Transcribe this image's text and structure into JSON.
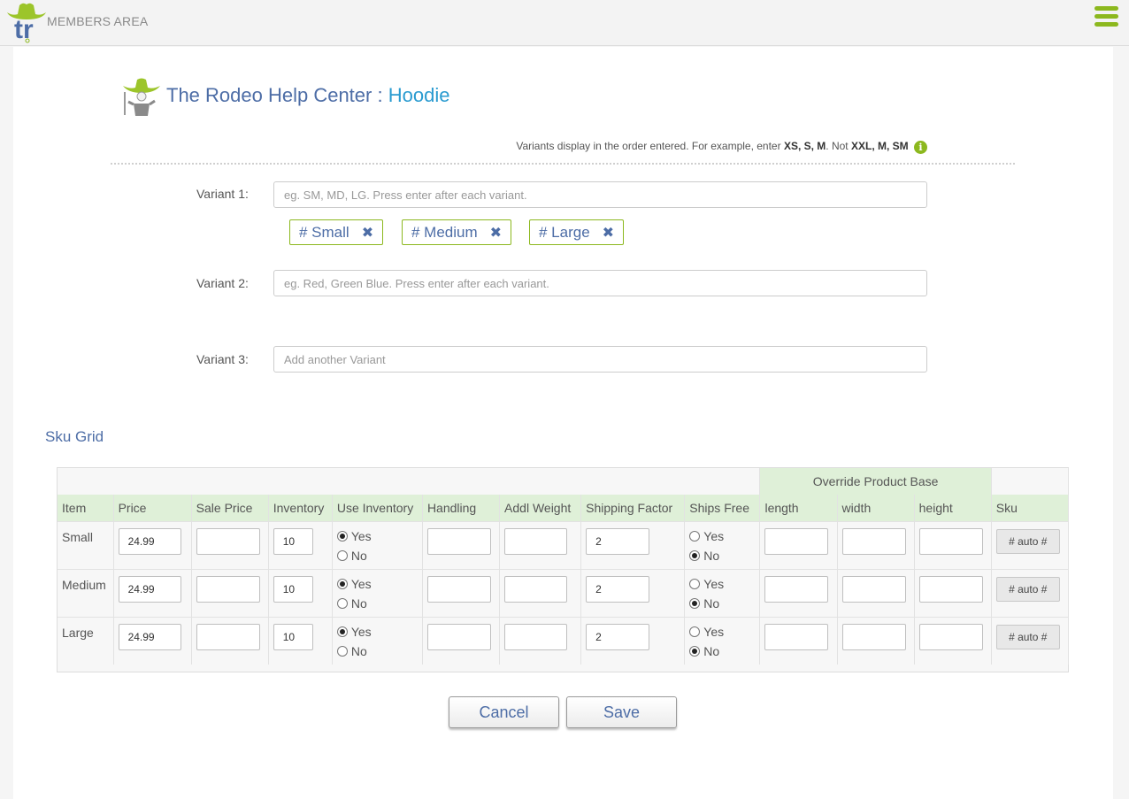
{
  "header": {
    "area_label": "MEMBERS AREA",
    "logo_text": "tr"
  },
  "page": {
    "site_name": "The Rodeo Help Center",
    "separator": ":",
    "product_name": "Hoodie"
  },
  "hint": {
    "prefix": "Variants display in the order entered. For example, enter",
    "good_example": "XS, S, M",
    "middle": ". Not",
    "bad_example": "XXL, M, SM"
  },
  "variants": [
    {
      "label": "Variant 1:",
      "placeholder": "eg. SM, MD, LG. Press enter after each variant.",
      "value": ""
    },
    {
      "label": "Variant 2:",
      "placeholder": "eg. Red, Green Blue. Press enter after each variant.",
      "value": ""
    },
    {
      "label": "Variant 3:",
      "placeholder": "Add another Variant",
      "value": ""
    }
  ],
  "variant1_tags": [
    "# Small",
    "# Medium",
    "# Large"
  ],
  "sku_grid": {
    "title": "Sku Grid",
    "override_label": "Override Product Base",
    "columns": [
      "Item",
      "Price",
      "Sale Price",
      "Inventory",
      "Use Inventory",
      "Handling",
      "Addl Weight",
      "Shipping Factor",
      "Ships Free",
      "length",
      "width",
      "height",
      "Sku"
    ],
    "yes_label": "Yes",
    "no_label": "No",
    "sku_button": "# auto #",
    "rows": [
      {
        "item": "Small",
        "price": "24.99",
        "sale_price": "",
        "inventory": "10",
        "use_inventory": "Yes",
        "handling": "",
        "addl_weight": "",
        "shipping_factor": "2",
        "ships_free": "No",
        "length": "",
        "width": "",
        "height": ""
      },
      {
        "item": "Medium",
        "price": "24.99",
        "sale_price": "",
        "inventory": "10",
        "use_inventory": "Yes",
        "handling": "",
        "addl_weight": "",
        "shipping_factor": "2",
        "ships_free": "No",
        "length": "",
        "width": "",
        "height": ""
      },
      {
        "item": "Large",
        "price": "24.99",
        "sale_price": "",
        "inventory": "10",
        "use_inventory": "Yes",
        "handling": "",
        "addl_weight": "",
        "shipping_factor": "2",
        "ships_free": "No",
        "length": "",
        "width": "",
        "height": ""
      }
    ]
  },
  "actions": {
    "cancel": "Cancel",
    "save": "Save"
  },
  "colors": {
    "accent_green": "#8cb81e",
    "title_blue": "#4d6da6",
    "product_blue": "#2a9bd0",
    "grid_header_bg": "#dff0d8"
  }
}
